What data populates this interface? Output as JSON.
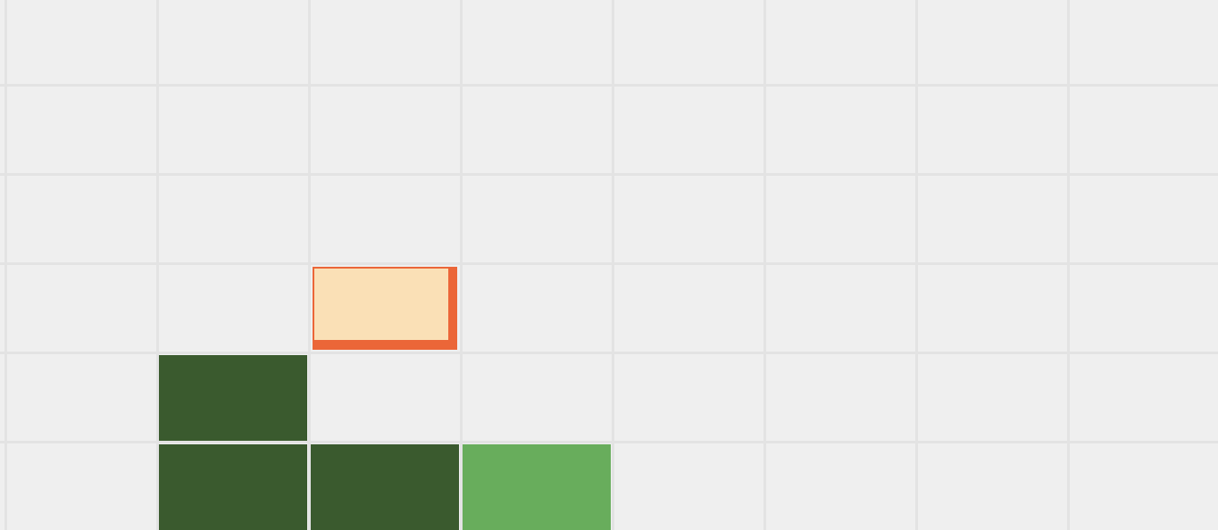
{
  "game": {
    "board": {
      "columns": 8,
      "rows": 6,
      "background": "#efefef",
      "grid_line_color": "#e3e3e3"
    },
    "colors": {
      "placed_dark": "#3a5a2e",
      "placed_light": "#68ad5c",
      "active_piece_face": "#fae0b6",
      "active_piece_border": "#eb6638"
    },
    "placed_tiles": [
      {
        "row": 4,
        "col": 1,
        "shade": "dark"
      },
      {
        "row": 5,
        "col": 1,
        "shade": "dark"
      },
      {
        "row": 5,
        "col": 2,
        "shade": "dark"
      },
      {
        "row": 5,
        "col": 3,
        "shade": "light"
      }
    ],
    "active_piece": {
      "row": 3,
      "col": 2
    }
  }
}
